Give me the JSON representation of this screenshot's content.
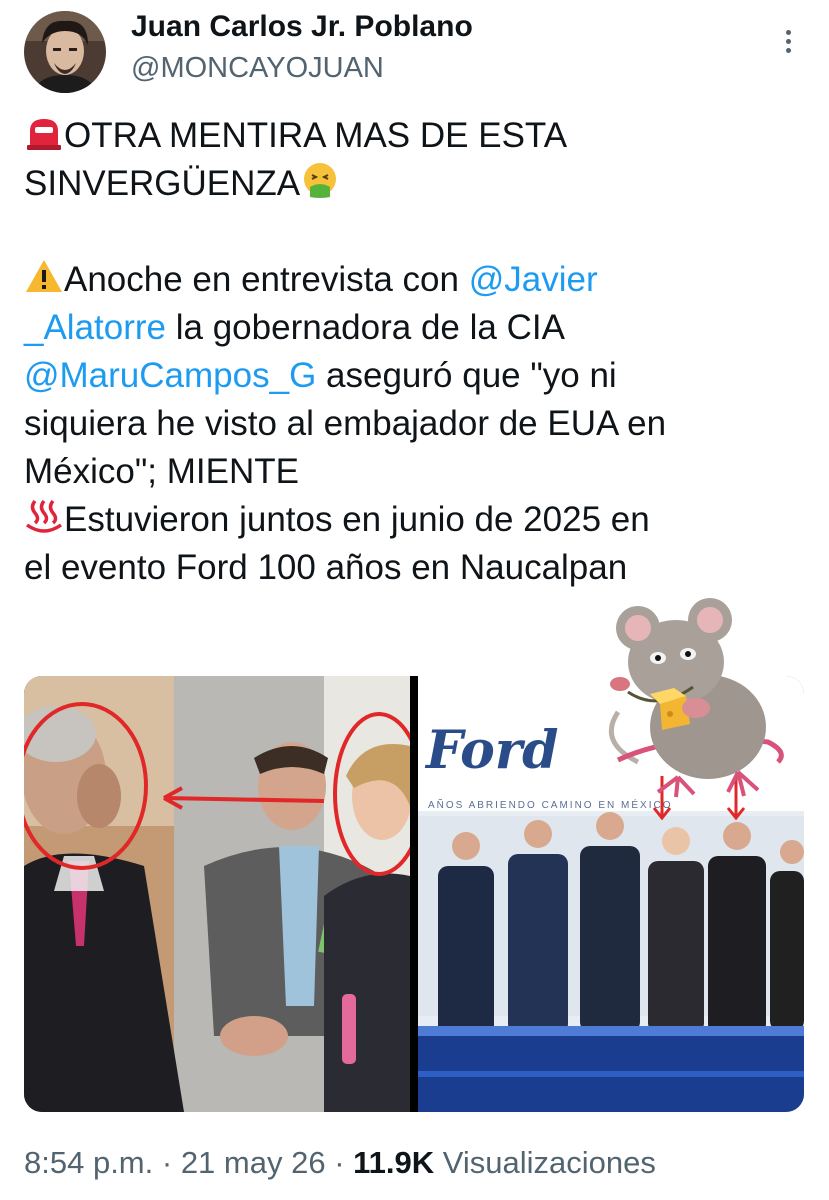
{
  "author": {
    "name": "Juan Carlos Jr. Poblano",
    "handle": "@MONCAYOJUAN"
  },
  "tweet": {
    "line1": "OTRA MENTIRA MAS DE ESTA",
    "line2": "SINVERGÜENZA",
    "line3_pre": "Anoche en entrevista con ",
    "line3_mention": "@Javier",
    "line4_mention": "_Alatorre",
    "line4_post": " la gobernadora de la CIA",
    "line5_mention": "@MaruCampos_G",
    "line5_post": " aseguró que \"yo ni",
    "line6": "siquiera he visto al embajador de EUA en",
    "line7": "México\"; MIENTE",
    "line8": "Estuvieron juntos en junio de 2025 en",
    "line9": "el evento Ford 100 años en Naucalpan"
  },
  "media": {
    "photo2_brand": "Ford",
    "photo2_banner": "AÑOS ABRIENDO CAMINO EN MÉXICO"
  },
  "meta": {
    "time": "8:54 p.m.",
    "sep1": " · ",
    "date": "21 may 26",
    "sep2": " · ",
    "views_count": "11.9K",
    "views_label": " Visualizaciones"
  },
  "icons": [
    "more-icon",
    "siren-icon",
    "nauseated-face-icon",
    "warning-icon",
    "hot-springs-icon",
    "rat-sticker"
  ],
  "colors": {
    "mention": "#1d9bf0",
    "secondary": "#536471",
    "text": "#0f1419"
  }
}
